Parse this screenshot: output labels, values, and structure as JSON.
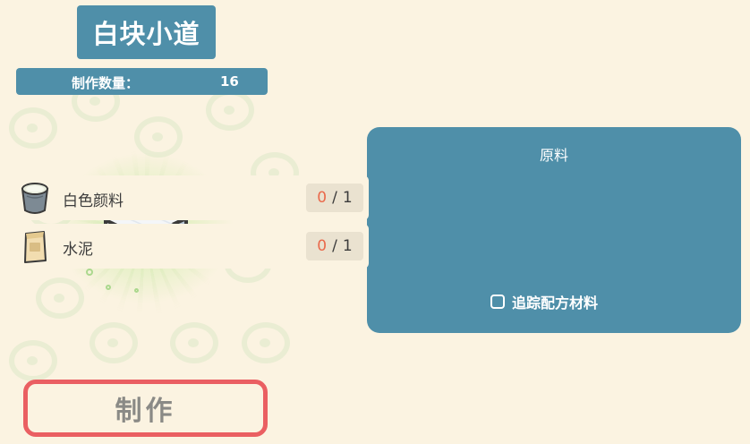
{
  "item": {
    "name": "白块小道",
    "icon": "white-block-path-icon"
  },
  "quantity": {
    "label": "制作数量：",
    "value": "16"
  },
  "craft_button": {
    "label": "制作"
  },
  "materials_panel": {
    "title": "原料",
    "items": [
      {
        "name": "白色颜料",
        "icon": "white-paint-bucket-icon",
        "have": "0",
        "need": "1"
      },
      {
        "name": "水泥",
        "icon": "cement-bag-icon",
        "have": "0",
        "need": "1"
      }
    ],
    "track_label": "追踪配方材料"
  },
  "colors": {
    "panel": "#4f8fa9",
    "background": "#fbf3e1",
    "craft_border": "#ea5f62",
    "count_have": "#ea6a4c"
  }
}
